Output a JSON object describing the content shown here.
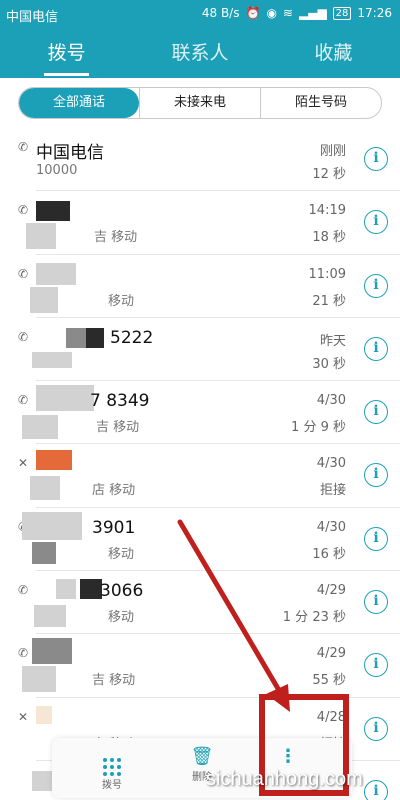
{
  "status": {
    "carrier": "中国电信",
    "speed": "48 B/s",
    "battery": "28",
    "time": "17:26"
  },
  "tabs": [
    {
      "label": "拨号",
      "active": true
    },
    {
      "label": "联系人",
      "active": false
    },
    {
      "label": "收藏",
      "active": false
    }
  ],
  "filters": [
    {
      "label": "全部通话",
      "active": true
    },
    {
      "label": "未接来电",
      "active": false
    },
    {
      "label": "陌生号码",
      "active": false
    }
  ],
  "calls": [
    {
      "name": "中国电信",
      "sub": "10000",
      "time": "刚刚",
      "duration": "12 秒",
      "type": "outgoing"
    },
    {
      "name": "",
      "sub": "吉 移动",
      "time": "14:19",
      "duration": "18 秒",
      "type": "outgoing"
    },
    {
      "name": "",
      "sub": "移动",
      "time": "11:09",
      "duration": "21 秒",
      "type": "outgoing"
    },
    {
      "name": "5222",
      "sub": "",
      "time": "昨天",
      "duration": "30 秒",
      "type": "outgoing"
    },
    {
      "name": "7 8349",
      "sub": "吉 移动",
      "time": "4/30",
      "duration": "1 分 9 秒",
      "type": "outgoing"
    },
    {
      "name": "",
      "sub": "店 移动",
      "time": "4/30",
      "duration": "拒接",
      "type": "missed"
    },
    {
      "name": "3901",
      "sub": "移动",
      "time": "4/30",
      "duration": "16 秒",
      "type": "outgoing"
    },
    {
      "name": "3066",
      "sub": "移动",
      "time": "4/29",
      "duration": "1 分 23 秒",
      "type": "outgoing"
    },
    {
      "name": "",
      "sub": "吉 移动",
      "time": "4/29",
      "duration": "55 秒",
      "type": "outgoing"
    },
    {
      "name": "",
      "sub": "店 移动",
      "time": "4/28",
      "duration": "拒接",
      "type": "missed"
    },
    {
      "name": "",
      "sub": "",
      "time": "",
      "duration": "",
      "type": "outgoing"
    }
  ],
  "bottom": {
    "dial_label": "拨号",
    "delete_label": "删除"
  },
  "watermark": "sichuanhong.com",
  "colors": {
    "accent": "#1ca0b7",
    "annotation": "#c0201d"
  }
}
